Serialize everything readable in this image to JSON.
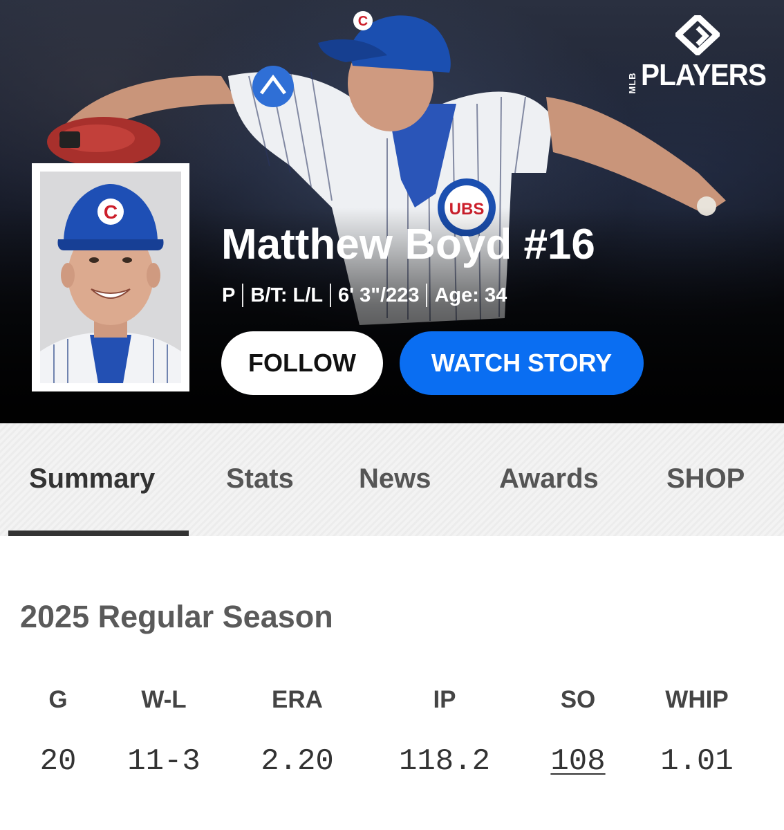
{
  "brand": {
    "logo_small": "MLB",
    "logo_main": "PLAYERS",
    "icon": "players-diamond-logo-icon"
  },
  "player": {
    "name": "Matthew Boyd #16",
    "position": "P",
    "bats_throws": "B/T: L/L",
    "height_weight": "6' 3\"/223",
    "age": "Age: 34"
  },
  "actions": {
    "follow_label": "FOLLOW",
    "watch_label": "WATCH STORY"
  },
  "colors": {
    "accent": "#0a6ef2",
    "cubs_blue": "#1b4fb0",
    "cubs_red": "#cc1f2b"
  },
  "tabs": [
    {
      "label": "Summary",
      "active": true
    },
    {
      "label": "Stats",
      "active": false
    },
    {
      "label": "News",
      "active": false
    },
    {
      "label": "Awards",
      "active": false
    },
    {
      "label": "SHOP",
      "active": false
    }
  ],
  "season": {
    "title": "2025 Regular Season",
    "stats": [
      {
        "label": "G",
        "value": "20"
      },
      {
        "label": "W-L",
        "value": "11-3"
      },
      {
        "label": "ERA",
        "value": "2.20"
      },
      {
        "label": "IP",
        "value": "118.2"
      },
      {
        "label": "SO",
        "value": "108"
      },
      {
        "label": "WHIP",
        "value": "1.01"
      }
    ]
  }
}
